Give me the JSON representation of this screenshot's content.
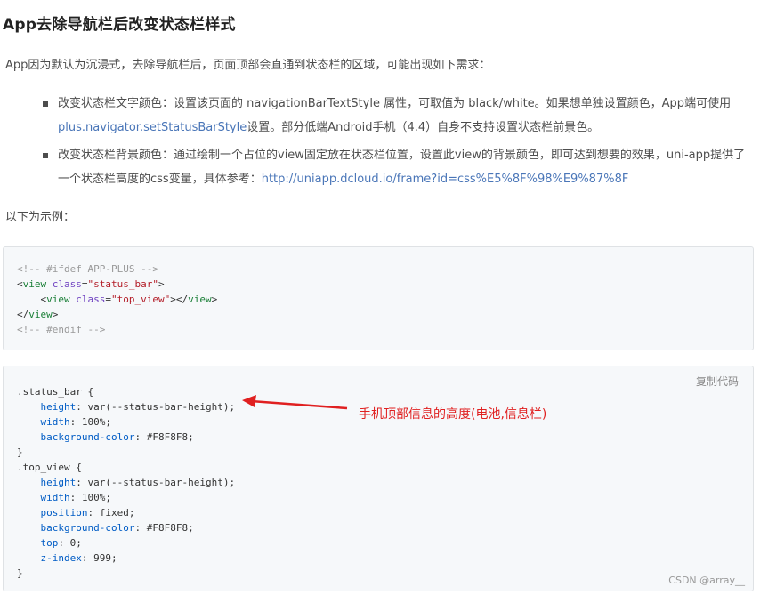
{
  "title": "App去除导航栏后改变状态栏样式",
  "intro": "App因为默认为沉浸式，去除导航栏后，页面顶部会直通到状态栏的区域，可能出现如下需求：",
  "bullets": [
    {
      "text_a": "改变状态栏文字颜色：设置该页面的 navigationBarTextStyle 属性，可取值为 black/white。如果想单独设置颜色，App端可使用 ",
      "link": "plus.navigator.setStatusBarStyle",
      "text_b": "设置。部分低端Android手机（4.4）自身不支持设置状态栏前景色。"
    },
    {
      "text_a": "改变状态栏背景颜色：通过绘制一个占位的view固定放在状态栏位置，设置此view的背景颜色，即可达到想要的效果，uni-app提供了一个状态栏高度的css变量，具体参考：",
      "link": "http://uniapp.dcloud.io/frame?id=css%E5%8F%98%E9%87%8F",
      "text_b": ""
    }
  ],
  "example_label": "以下为示例：",
  "code1": {
    "comment_start": "<!-- #ifdef APP-PLUS -->",
    "tag_view": "view",
    "attr_class": "class",
    "val_status_bar": "\"status_bar\"",
    "val_top_view": "\"top_view\"",
    "comment_end": "<!-- #endif -->"
  },
  "code2": {
    "copy_label": "复制代码",
    "sel_status_bar": ".status_bar {",
    "sel_top_view": ".top_view {",
    "close_brace": "}",
    "p_height": "height",
    "v_height": " var(--status-bar-height);",
    "p_width": "width",
    "v_width": " 100%;",
    "p_bg": "background-color",
    "v_bg": " #F8F8F8;",
    "p_position": "position",
    "v_position": " fixed;",
    "p_top": "top",
    "v_top": " 0;",
    "p_z": "z-index",
    "v_z": " 999;"
  },
  "annotation": "手机顶部信息的高度(电池,信息栏)",
  "watermark": "CSDN @array__",
  "colors": {
    "annotation": "#e02020",
    "link": "#4a76b8",
    "code_bg": "#f6f8fa"
  }
}
